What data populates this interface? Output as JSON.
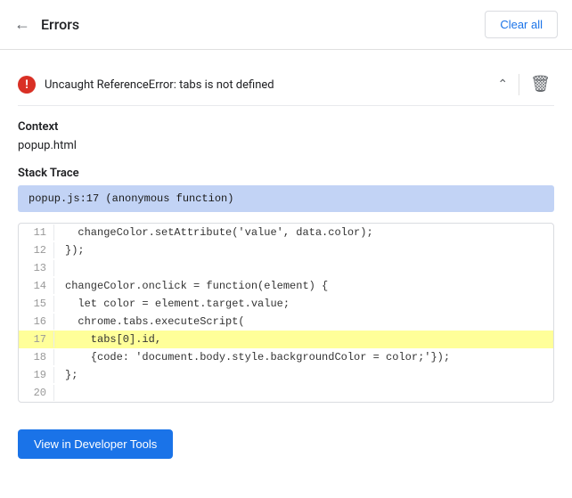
{
  "header": {
    "back_label": "←",
    "title": "Errors",
    "clear_all_label": "Clear all"
  },
  "error": {
    "message": "Uncaught ReferenceError: tabs is not defined"
  },
  "context": {
    "label": "Context",
    "file": "popup.html"
  },
  "stack_trace": {
    "label": "Stack Trace",
    "entry": "popup.js:17 (anonymous function)"
  },
  "code": {
    "lines": [
      {
        "num": "11",
        "text": "  changeColor.setAttribute('value', data.color);",
        "highlight": false
      },
      {
        "num": "12",
        "text": "});",
        "highlight": false
      },
      {
        "num": "13",
        "text": "",
        "highlight": false
      },
      {
        "num": "14",
        "text": "changeColor.onclick = function(element) {",
        "highlight": false
      },
      {
        "num": "15",
        "text": "  let color = element.target.value;",
        "highlight": false
      },
      {
        "num": "16",
        "text": "  chrome.tabs.executeScript(",
        "highlight": false
      },
      {
        "num": "17",
        "text": "    tabs[0].id,",
        "highlight": true
      },
      {
        "num": "18",
        "text": "    {code: 'document.body.style.backgroundColor = color;'});",
        "highlight": false
      },
      {
        "num": "19",
        "text": "};",
        "highlight": false
      },
      {
        "num": "20",
        "text": "",
        "highlight": false
      }
    ]
  },
  "footer": {
    "dev_tools_label": "View in Developer Tools"
  }
}
